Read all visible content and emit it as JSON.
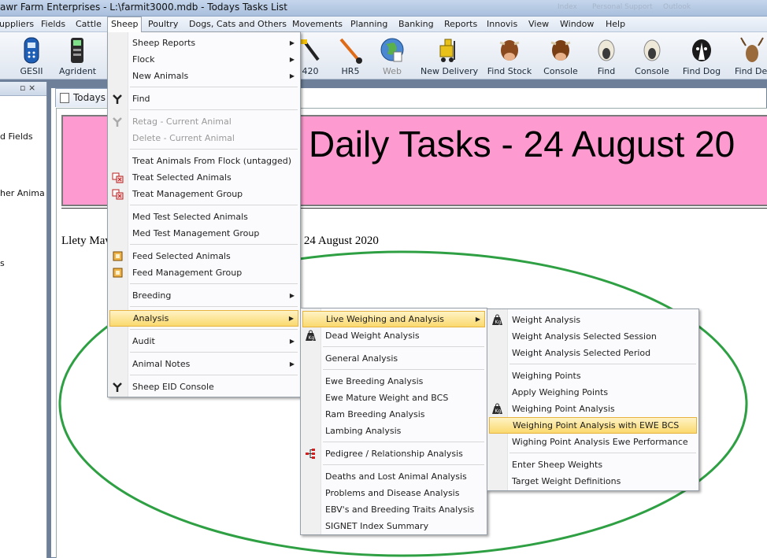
{
  "window": {
    "title": "awr Farm Enterprises - L:\\farmit3000.mdb - Todays Tasks List",
    "ghost_1": "Index",
    "ghost_2": "Personal Support",
    "ghost_3": "Outlook"
  },
  "menubar": [
    "uppliers",
    "Fields",
    "Cattle",
    "Sheep",
    "Poultry",
    "Dogs, Cats and Others",
    "Movements",
    "Planning",
    "Banking",
    "Reports",
    "Innovis",
    "View",
    "Window",
    "Help"
  ],
  "toolbar": [
    "GESII",
    "Agrident",
    "420",
    "HR5",
    "Web",
    "New Delivery",
    "Find Stock",
    "Console",
    "Find",
    "Console",
    "Find Dog",
    "Find De"
  ],
  "left_pane": {
    "pin": "▫ ⨯",
    "labels": [
      "d Fields",
      "her Anima",
      "s"
    ]
  },
  "document": {
    "tab": "Todays T",
    "banner": "Daily Tasks - 24 August 20",
    "farm_left": "Llety Maw",
    "farm_right": "ay 24 August 2020"
  },
  "sheep_menu": {
    "items": [
      {
        "label": "Sheep Reports",
        "submenu": true
      },
      {
        "label": "Flock",
        "submenu": true
      },
      {
        "label": "New Animals",
        "submenu": true
      },
      {
        "label": "Find"
      },
      {
        "label": "Retag - Current Animal",
        "disabled": true
      },
      {
        "label": "Delete - Current Animal",
        "disabled": true
      },
      {
        "label": "Treat Animals From Flock (untagged)"
      },
      {
        "label": "Treat Selected Animals"
      },
      {
        "label": "Treat Management Group"
      },
      {
        "label": "Med Test Selected Animals"
      },
      {
        "label": "Med Test Management Group"
      },
      {
        "label": "Feed Selected Animals"
      },
      {
        "label": "Feed Management Group"
      },
      {
        "label": "Breeding",
        "submenu": true
      },
      {
        "label": "Analysis",
        "submenu": true,
        "highlighted": true
      },
      {
        "label": "Audit",
        "submenu": true
      },
      {
        "label": "Animal Notes",
        "submenu": true
      },
      {
        "label": "Sheep EID Console"
      }
    ]
  },
  "analysis_menu": {
    "items": [
      {
        "label": "Live Weighing and Analysis",
        "submenu": true,
        "highlighted": true
      },
      {
        "label": "Dead Weight Analysis"
      },
      {
        "label": "General Analysis"
      },
      {
        "label": "Ewe Breeding Analysis"
      },
      {
        "label": "Ewe Mature Weight and BCS"
      },
      {
        "label": "Ram Breeding Analysis"
      },
      {
        "label": "Lambing Analysis"
      },
      {
        "label": "Pedigree / Relationship Analysis"
      },
      {
        "label": "Deaths and Lost Animal Analysis"
      },
      {
        "label": "Problems and Disease Analysis"
      },
      {
        "label": "EBV's and Breeding Traits Analysis"
      },
      {
        "label": "SIGNET Index Summary"
      }
    ]
  },
  "weighing_menu": {
    "items": [
      {
        "label": "Weight Analysis"
      },
      {
        "label": "Weight Analysis Selected Session"
      },
      {
        "label": "Weight Analysis Selected Period"
      },
      {
        "label": "Weighing Points"
      },
      {
        "label": "Apply Weighing Points"
      },
      {
        "label": "Weighing Point Analysis"
      },
      {
        "label": "Weighing Point Analysis with EWE BCS",
        "highlighted": true
      },
      {
        "label": "Wighing Point Analysis Ewe Performance"
      },
      {
        "label": "Enter Sheep Weights"
      },
      {
        "label": "Target Weight Definitions"
      }
    ]
  },
  "colors": {
    "banner_pink": "#fd9bd0",
    "highlight": "#fad96e",
    "annotation_ellipse": "#2ea043"
  }
}
